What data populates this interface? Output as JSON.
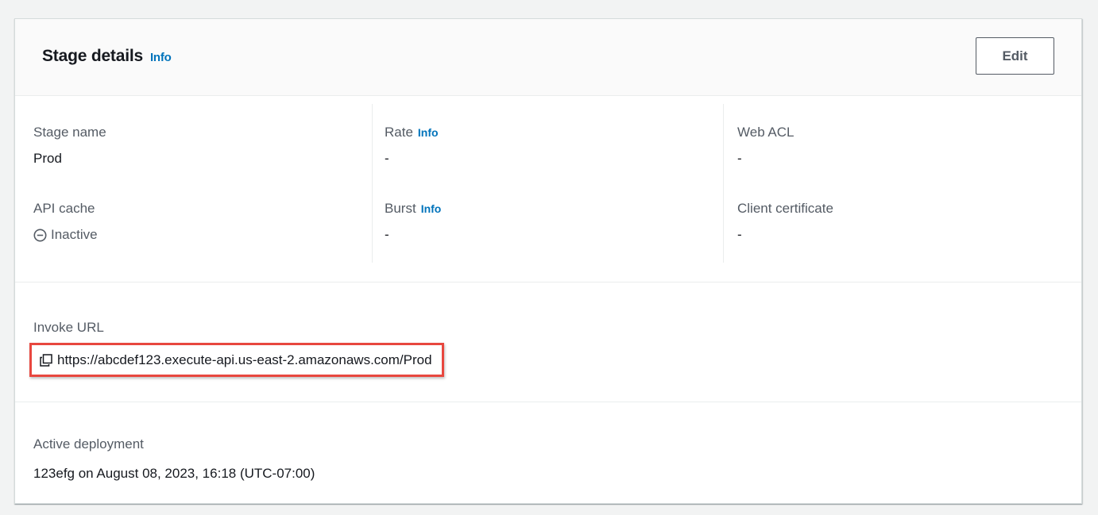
{
  "header": {
    "title": "Stage details",
    "info_label": "Info",
    "edit_label": "Edit"
  },
  "details": {
    "stage_name": {
      "label": "Stage name",
      "value": "Prod"
    },
    "api_cache": {
      "label": "API cache",
      "value": "Inactive",
      "icon": "status-stopped-icon"
    },
    "rate": {
      "label": "Rate",
      "info_label": "Info",
      "value": "-"
    },
    "burst": {
      "label": "Burst",
      "info_label": "Info",
      "value": "-"
    },
    "web_acl": {
      "label": "Web ACL",
      "value": "-"
    },
    "client_certificate": {
      "label": "Client certificate",
      "value": "-"
    }
  },
  "invoke": {
    "label": "Invoke URL",
    "url": "https://abcdef123.execute-api.us-east-2.amazonaws.com/Prod",
    "icon": "copy-icon"
  },
  "deployment": {
    "label": "Active deployment",
    "value": "123efg on August 08, 2023, 16:18 (UTC-07:00)"
  },
  "colors": {
    "link": "#0073bb",
    "highlight_border": "#e8473f",
    "text": "#16191f",
    "label_text": "#545b64"
  }
}
